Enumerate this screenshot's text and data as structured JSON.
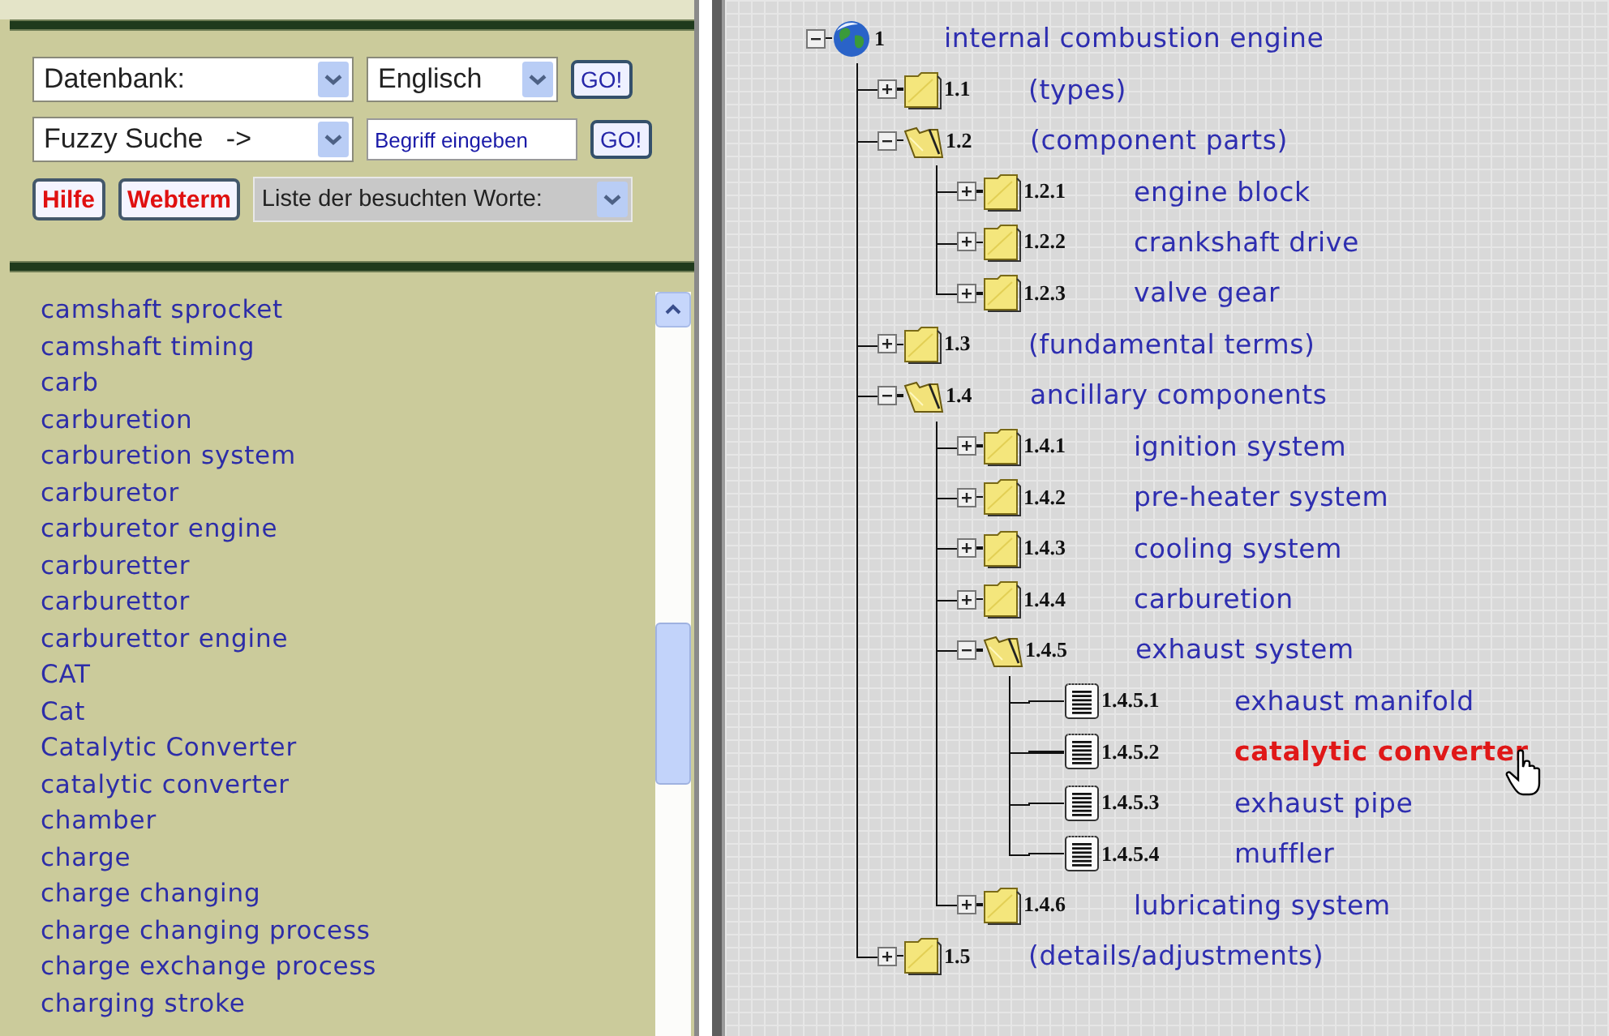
{
  "search_form": {
    "database": "Datenbank:",
    "language": "Englisch",
    "go_button_1": "GO!",
    "search_mode": "Fuzzy Suche   ->",
    "term_field": {
      "value": "Begriff eingeben"
    },
    "go_button_2": "GO!",
    "help_button": "Hilfe",
    "webterm_button": "Webterm",
    "history_select": "Liste der besuchten Worte:"
  },
  "word_list": {
    "items": [
      "camshaft sprocket",
      "camshaft timing",
      "carb",
      "carburetion",
      "carburetion system",
      "carburetor",
      "carburetor engine",
      "carburetter",
      "carburettor",
      "carburettor engine",
      "CAT",
      "Cat",
      "Catalytic Converter",
      "catalytic converter",
      "chamber",
      "charge",
      "charge changing",
      "charge changing process",
      "charge exchange process",
      "charging stroke"
    ]
  },
  "tree": {
    "root": {
      "kind": "globe",
      "number": "1",
      "label": "internal combustion engine",
      "expanded": true,
      "selected": false,
      "children": [
        {
          "kind": "folder",
          "number": "1.1",
          "label": "(types)",
          "expanded": false,
          "selected": false
        },
        {
          "kind": "folder",
          "number": "1.2",
          "label": "(component parts)",
          "expanded": true,
          "selected": false,
          "children": [
            {
              "kind": "folder",
              "number": "1.2.1",
              "label": "engine block",
              "expanded": false,
              "selected": false
            },
            {
              "kind": "folder",
              "number": "1.2.2",
              "label": "crankshaft drive",
              "expanded": false,
              "selected": false
            },
            {
              "kind": "folder",
              "number": "1.2.3",
              "label": "valve gear",
              "expanded": false,
              "selected": false
            }
          ]
        },
        {
          "kind": "folder",
          "number": "1.3",
          "label": "(fundamental terms)",
          "expanded": false,
          "selected": false
        },
        {
          "kind": "folder",
          "number": "1.4",
          "label": "ancillary components",
          "expanded": true,
          "selected": false,
          "children": [
            {
              "kind": "folder",
              "number": "1.4.1",
              "label": "ignition system",
              "expanded": false,
              "selected": false
            },
            {
              "kind": "folder",
              "number": "1.4.2",
              "label": "pre-heater system",
              "expanded": false,
              "selected": false
            },
            {
              "kind": "folder",
              "number": "1.4.3",
              "label": "cooling system",
              "expanded": false,
              "selected": false
            },
            {
              "kind": "folder",
              "number": "1.4.4",
              "label": "carburetion",
              "expanded": false,
              "selected": false
            },
            {
              "kind": "folder",
              "number": "1.4.5",
              "label": "exhaust system",
              "expanded": true,
              "selected": false,
              "children": [
                {
                  "kind": "document",
                  "number": "1.4.5.1",
                  "label": "exhaust manifold",
                  "selected": false
                },
                {
                  "kind": "document",
                  "number": "1.4.5.2",
                  "label": "catalytic converter",
                  "selected": true
                },
                {
                  "kind": "document",
                  "number": "1.4.5.3",
                  "label": "exhaust pipe",
                  "selected": false
                },
                {
                  "kind": "document",
                  "number": "1.4.5.4",
                  "label": "muffler",
                  "selected": false
                }
              ]
            },
            {
              "kind": "folder",
              "number": "1.4.6",
              "label": "lubricating system",
              "expanded": false,
              "selected": false
            }
          ]
        },
        {
          "kind": "folder",
          "number": "1.5",
          "label": "(details/adjustments)",
          "expanded": false,
          "selected": false
        }
      ]
    }
  }
}
